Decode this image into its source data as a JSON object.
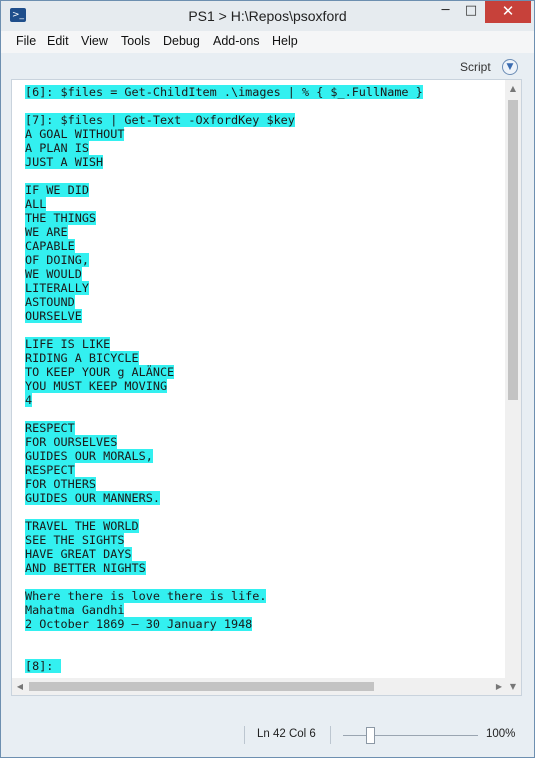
{
  "window": {
    "title": "PS1 > H:\\Repos\\psoxford",
    "minimize": "─",
    "maximize": "□",
    "close": "✕",
    "app_icon": "powershell-icon"
  },
  "menu": [
    "File",
    "Edit",
    "View",
    "Tools",
    "Debug",
    "Add-ons",
    "Help"
  ],
  "pane": {
    "label": "Script",
    "toggle_icon": "chevron-down-icon"
  },
  "console": {
    "lines": [
      {
        "text": "[6]: $files = Get-ChildItem .\\images | % { $_.FullName }",
        "hl": true
      },
      {
        "text": "",
        "hl": false
      },
      {
        "text": "[7]: $files | Get-Text -OxfordKey $key",
        "hl": true
      },
      {
        "text": "A GOAL WITHOUT",
        "hl": true
      },
      {
        "text": "A PLAN IS",
        "hl": true
      },
      {
        "text": "JUST A WISH",
        "hl": true
      },
      {
        "text": "",
        "hl": false
      },
      {
        "text": "IF WE DID",
        "hl": true
      },
      {
        "text": "ALL",
        "hl": true
      },
      {
        "text": "THE THINGS",
        "hl": true
      },
      {
        "text": "WE ARE",
        "hl": true
      },
      {
        "text": "CAPABLE",
        "hl": true
      },
      {
        "text": "OF DOING,",
        "hl": true
      },
      {
        "text": "WE WOULD",
        "hl": true
      },
      {
        "text": "LITERALLY",
        "hl": true
      },
      {
        "text": "ASTOUND",
        "hl": true
      },
      {
        "text": "OURSELVE",
        "hl": true
      },
      {
        "text": "",
        "hl": false
      },
      {
        "text": "LIFE IS LIKE",
        "hl": true
      },
      {
        "text": "RIDING A BICYCLE",
        "hl": true
      },
      {
        "text": "TO KEEP YOUR g ALÄNCE",
        "hl": true
      },
      {
        "text": "YOU MUST KEEP MOVING",
        "hl": true
      },
      {
        "text": "4",
        "hl": true
      },
      {
        "text": "",
        "hl": false
      },
      {
        "text": "RESPECT",
        "hl": true
      },
      {
        "text": "FOR OURSELVES",
        "hl": true
      },
      {
        "text": "GUIDES OUR MORALS,",
        "hl": true
      },
      {
        "text": "RESPECT",
        "hl": true
      },
      {
        "text": "FOR OTHERS",
        "hl": true
      },
      {
        "text": "GUIDES OUR MANNERS.",
        "hl": true
      },
      {
        "text": "",
        "hl": false
      },
      {
        "text": "TRAVEL THE WORLD",
        "hl": true
      },
      {
        "text": "SEE THE SIGHTS",
        "hl": true
      },
      {
        "text": "HAVE GREAT DAYS",
        "hl": true
      },
      {
        "text": "AND BETTER NIGHTS",
        "hl": true
      },
      {
        "text": "",
        "hl": false
      },
      {
        "text": "Where there is love there is life.",
        "hl": true
      },
      {
        "text": "Mahatma Gandhi",
        "hl": true
      },
      {
        "text": "2 October 1869 – 30 January 1948",
        "hl": true
      },
      {
        "text": "",
        "hl": false
      },
      {
        "text": "",
        "hl": false
      },
      {
        "text": "[8]: ",
        "hl": true
      }
    ]
  },
  "status": {
    "position": "Ln 42  Col 6",
    "zoom": "100%",
    "zoom_level_fraction": 0.2
  },
  "colors": {
    "highlight": "#33f0f0",
    "close_button": "#c7413a"
  }
}
